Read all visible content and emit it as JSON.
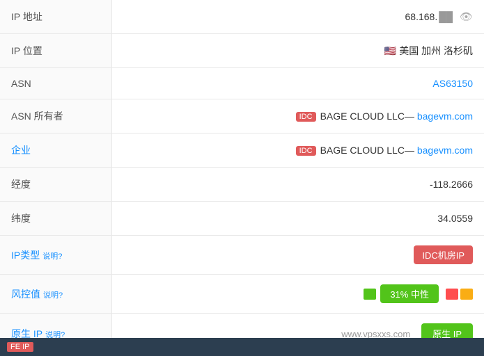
{
  "rows": [
    {
      "id": "ip-address",
      "label": "IP 地址",
      "label_link": false,
      "type": "ip"
    },
    {
      "id": "ip-location",
      "label": "IP 位置",
      "label_link": false,
      "type": "location"
    },
    {
      "id": "asn",
      "label": "ASN",
      "label_link": false,
      "type": "asn"
    },
    {
      "id": "asn-owner",
      "label": "ASN 所有者",
      "label_link": false,
      "type": "asn-owner"
    },
    {
      "id": "enterprise",
      "label": "企业",
      "label_link": true,
      "type": "enterprise"
    },
    {
      "id": "longitude",
      "label": "经度",
      "label_link": false,
      "value": "-118.2666",
      "type": "plain"
    },
    {
      "id": "latitude",
      "label": "纬度",
      "label_link": false,
      "value": "34.0559",
      "type": "plain"
    },
    {
      "id": "ip-type",
      "label": "IP类型",
      "label_link": true,
      "explain": "说明?",
      "type": "ip-type"
    },
    {
      "id": "risk-value",
      "label": "风控值",
      "label_link": true,
      "explain": "说明?",
      "type": "risk"
    },
    {
      "id": "native-ip",
      "label": "原生 IP",
      "label_link": true,
      "explain": "说明?",
      "type": "native"
    }
  ],
  "ip": {
    "visible": "68.168.",
    "hidden": "███",
    "eye_label": "👁"
  },
  "location": {
    "flag": "🇺🇸",
    "text": "美国 加州 洛杉矶"
  },
  "asn": {
    "text": "AS63150",
    "href": "#"
  },
  "asn_owner": {
    "badge": "IDC",
    "company": "BAGE CLOUD LLC",
    "separator": "—",
    "site": "bagevm.com",
    "site_href": "#"
  },
  "enterprise": {
    "badge": "IDC",
    "company": "BAGE CLOUD LLC",
    "separator": "—",
    "site": "bagevm.com",
    "site_href": "#"
  },
  "ip_type": {
    "badge": "IDC机房IP"
  },
  "risk": {
    "percent": "31%",
    "label": "中性"
  },
  "native": {
    "site": "www.vpsxxs.com",
    "btn_label": "原生 IP"
  },
  "footer": {
    "tag": "FE IP",
    "text": ""
  }
}
